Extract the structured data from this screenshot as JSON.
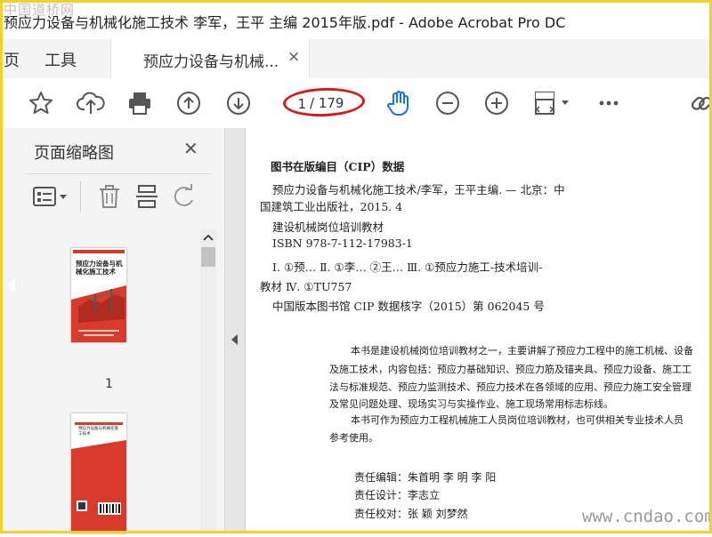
{
  "watermark_top": "中国道桥网",
  "window": {
    "title": "预应力设备与机械化施工技术 李军，王平 主编 2015年版.pdf - Adobe Acrobat Pro DC"
  },
  "tabs": {
    "home": "页",
    "tools": "工具",
    "document": "预应力设备与机械...",
    "close_symbol": "×"
  },
  "toolbar": {
    "page_current": "1",
    "page_total": "/ 179",
    "icons": [
      "star-icon",
      "cloud-upload-icon",
      "print-icon",
      "page-up-icon",
      "page-down-icon",
      "hand-tool-icon",
      "zoom-out-icon",
      "zoom-in-icon",
      "fit-page-icon",
      "more-icon",
      "link-icon"
    ],
    "accent": "#1473e6"
  },
  "sidebar": {
    "title": "页面缩略图",
    "close_symbol": "✕",
    "thumbnails": [
      {
        "page_label": "1",
        "cover_title": "预应力设备与机械化施工技术"
      },
      {
        "cover_title": "预应力设备与机械化施工技术"
      }
    ]
  },
  "document": {
    "cip_heading": "图书在版编目（CIP）数据",
    "lines": [
      "预应力设备与机械化施工技术/李军，王平主编. — 北京：中",
      "国建筑工业出版社，2015. 4",
      "建设机械岗位培训教材",
      "ISBN 978-7-112-17983-1",
      "Ⅰ. ①预…   Ⅱ. ①李…  ②王…   Ⅲ. ①预应力施工-技术培训-",
      "教材   Ⅳ. ①TU757",
      "中国版本图书馆 CIP 数据核字（2015）第 062045 号"
    ],
    "summary": [
      "本书是建设机械岗位培训教材之一，主要讲解了预应力工程中的施工机械、设备",
      "及施工技术，内容包括：预应力基础知识、预应力筋及锚夹具、预应力设备、施工工",
      "法与标准规范、预应力监测技术、预应力技术在各领域的应用、预应力施工安全管理",
      "及常见问题处理、现场实习与实操作业、施工现场常用标志标线。",
      "本书可作为预应力工程机械施工人员岗位培训教材，也可供相关专业技术人员",
      "参考使用。"
    ],
    "credits": [
      "责任编辑：朱首明    李   明    李   阳",
      "责任设计：李志立",
      "责任校对：张   颖    刘梦然"
    ]
  },
  "watermark_bottom": "www.cndao.com"
}
